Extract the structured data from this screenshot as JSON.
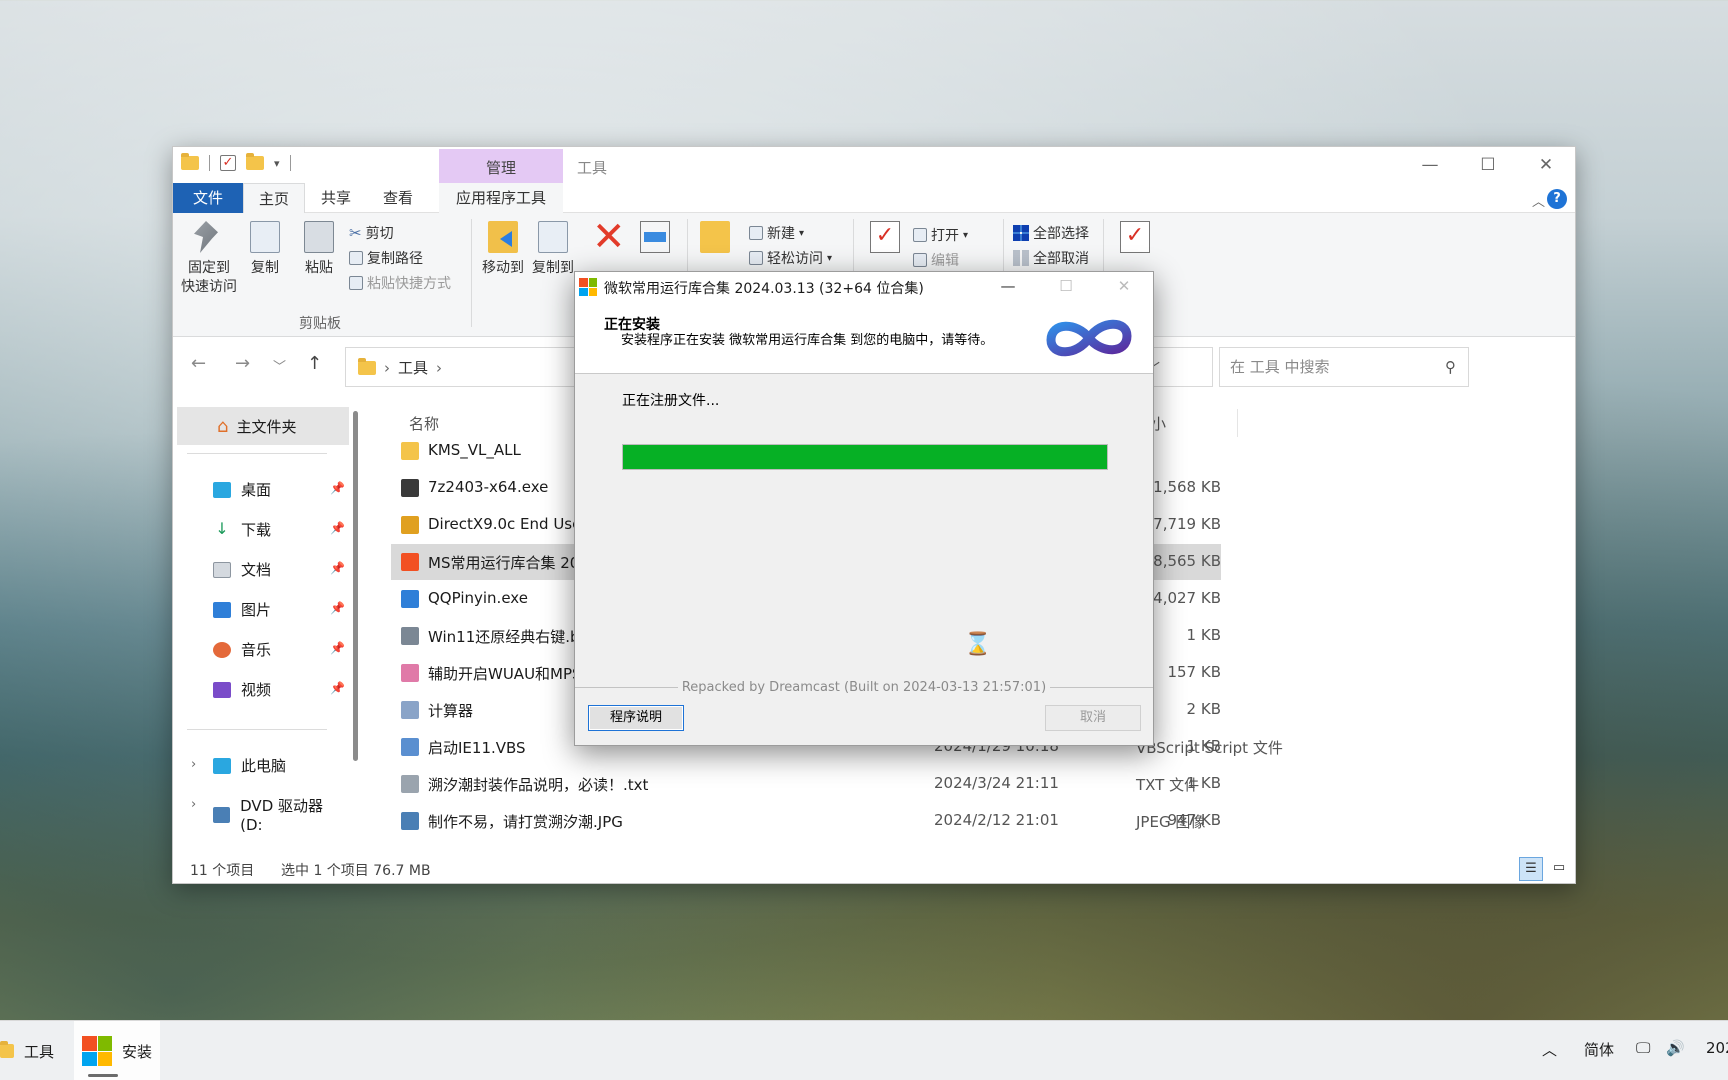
{
  "explorer": {
    "title": "工具",
    "context_tab": "管理",
    "tabs": [
      "文件",
      "主页",
      "共享",
      "查看",
      "应用程序工具"
    ],
    "ribbon": {
      "pin_label": "固定到\n快速访问",
      "copy_label": "复制",
      "paste_label": "粘贴",
      "cut_label": "剪切",
      "copy_path_label": "复制路径",
      "paste_shortcut_label": "粘贴快捷方式",
      "clipboard_group": "剪贴板",
      "move_to_label": "移动到",
      "copy_to_label": "复制到",
      "new_label": "新建",
      "easy_access_label": "轻松访问",
      "open_label": "打开",
      "edit_label": "编辑",
      "select_all_label": "全部选择",
      "select_none_label": "全部取消"
    },
    "address": {
      "path": "工具",
      "search_placeholder": "在 工具 中搜索"
    },
    "nav": {
      "home": "主文件夹",
      "quick": [
        "桌面",
        "下载",
        "文档",
        "图片",
        "音乐",
        "视频"
      ],
      "this_pc": "此电脑",
      "dvd": "DVD 驱动器 (D:"
    },
    "columns": {
      "name": "名称",
      "size": "小"
    },
    "files": [
      {
        "name": "KMS_VL_ALL",
        "date": "",
        "type": "",
        "size": ""
      },
      {
        "name": "7z2403-x64.exe",
        "date": "",
        "type": "",
        "size": "1,568 KB"
      },
      {
        "name": "DirectX9.0c End User",
        "date": "",
        "type": "",
        "size": "17,719 KB"
      },
      {
        "name": "MS常用运行库合集 202",
        "date": "",
        "type": "",
        "size": "78,565 KB"
      },
      {
        "name": "QQPinyin.exe",
        "date": "",
        "type": "",
        "size": "44,027 KB"
      },
      {
        "name": "Win11还原经典右键.ba",
        "date": "",
        "type": "",
        "size": "1 KB"
      },
      {
        "name": "辅助开启WUAU和MPS",
        "date": "",
        "type": "",
        "size": "157 KB"
      },
      {
        "name": "计算器",
        "date": "",
        "type": "",
        "size": "2 KB"
      },
      {
        "name": "启动IE11.VBS",
        "date": "2024/1/29 10:18",
        "type": "VBScript Script 文件",
        "size": "1 KB"
      },
      {
        "name": "溯汐潮封装作品说明，必读！.txt",
        "date": "2024/3/24 21:11",
        "type": "TXT 文件",
        "size": "1 KB"
      },
      {
        "name": "制作不易，请打赏溯汐潮.JPG",
        "date": "2024/2/12 21:01",
        "type": "JPEG 图像",
        "size": "947 KB"
      }
    ],
    "status": {
      "count": "11 个项目",
      "selected": "选中 1 个项目  76.7 MB"
    }
  },
  "installer": {
    "title": "微软常用运行库合集 2024.03.13 (32+64 位合集)",
    "heading": "正在安装",
    "subheading": "安装程序正在安装 微软常用运行库合集 到您的电脑中，请等待。",
    "status": "正在注册文件...",
    "progress": 1.0,
    "branding": "Repacked by Dreamcast (Built on 2024-03-13 21:57:01)",
    "readme_button": "程序说明",
    "cancel_button": "取消"
  },
  "taskbar": {
    "items": [
      "工具",
      "安装"
    ],
    "ime": "简体",
    "clock_partial": "202"
  },
  "colors": {
    "accent": "#1e62b4",
    "progress": "#06b025",
    "context_tab": "#e4c9f4",
    "selected_row": "#d9d9d9"
  }
}
